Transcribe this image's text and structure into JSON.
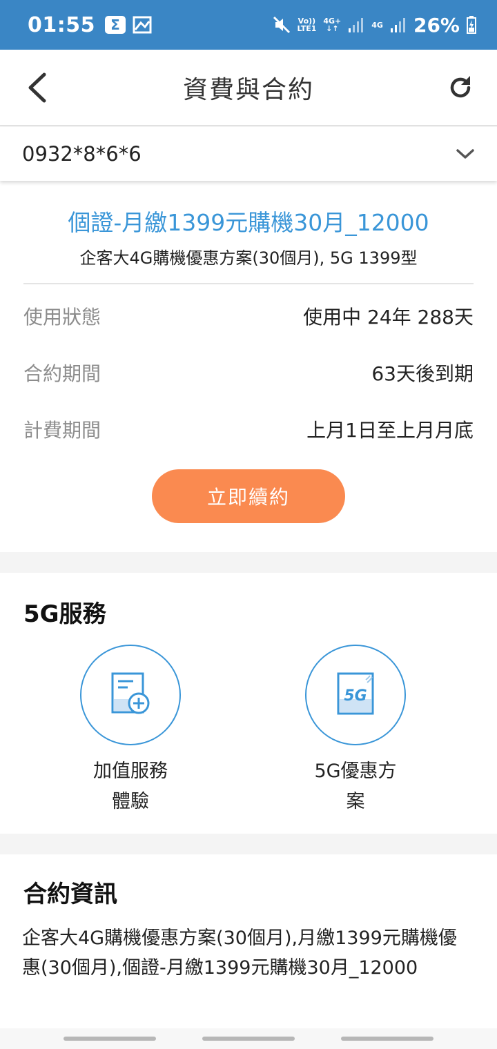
{
  "status_bar": {
    "time": "01:55",
    "sigma_icon": "sigma-icon",
    "volte_label": "Vo))",
    "lte_label": "LTE1",
    "sim1_label": "4G+",
    "sim2_label": "4G",
    "battery_percent": "26%"
  },
  "header": {
    "title": "資費與合約"
  },
  "number_selector": {
    "value": "0932*8*6*6"
  },
  "plan": {
    "name": "個證-月繳1399元購機30月_12000",
    "description": "企客大4G購機優惠方案(30個月), 5G 1399型",
    "rows": [
      {
        "label": "使用狀態",
        "value": "使用中 24年 288天"
      },
      {
        "label": "合約期間",
        "value": "63天後到期"
      },
      {
        "label": "計費期間",
        "value": "上月1日至上月月底"
      }
    ],
    "renew_label": "立即續約"
  },
  "services": {
    "title": "5G服務",
    "items": [
      {
        "line1": "加值服務",
        "line2": "體驗",
        "icon": "document-plus-icon"
      },
      {
        "line1": "5G優惠方",
        "line2": "案",
        "icon": "5g-card-icon"
      }
    ],
    "icon_text": "5G"
  },
  "contract": {
    "title": "合約資訊",
    "text": "企客大4G購機優惠方案(30個月),月繳1399元購機優惠(30個月),個證-月繳1399元購機30月_12000"
  },
  "colors": {
    "status_bar": "#3a86c5",
    "accent_blue": "#3a96d8",
    "renew_orange": "#fa8a50"
  }
}
